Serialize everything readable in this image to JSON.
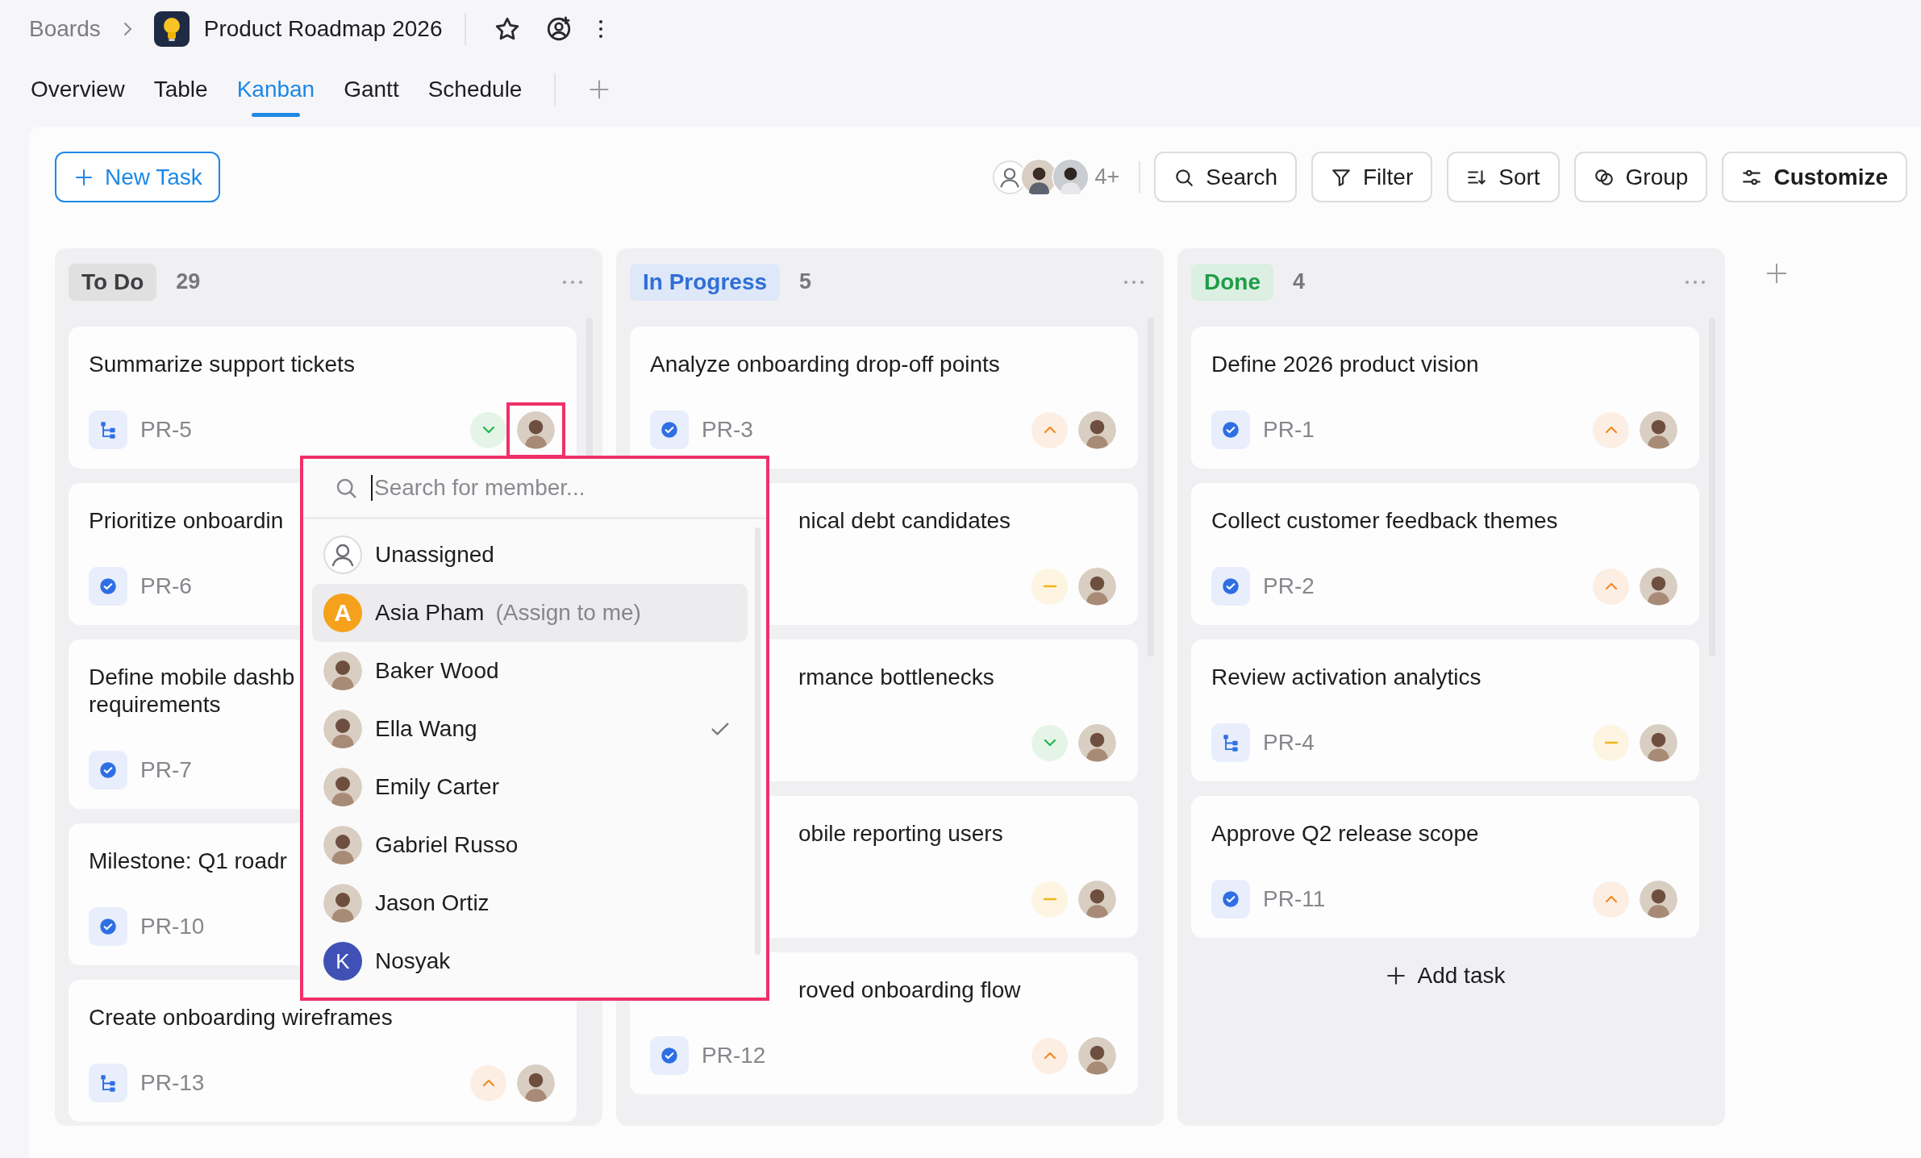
{
  "breadcrumb": {
    "parent": "Boards",
    "title": "Product Roadmap 2026"
  },
  "views": [
    {
      "label": "Overview",
      "selected": false
    },
    {
      "label": "Table",
      "selected": false
    },
    {
      "label": "Kanban",
      "selected": true
    },
    {
      "label": "Gantt",
      "selected": false
    },
    {
      "label": "Schedule",
      "selected": false
    }
  ],
  "new_task_button": "New Task",
  "members_more": "4+",
  "toolbar": [
    {
      "label": "Search",
      "kind": "search",
      "primary": false
    },
    {
      "label": "Filter",
      "kind": "filter",
      "primary": false
    },
    {
      "label": "Sort",
      "kind": "sort",
      "primary": false
    },
    {
      "label": "Group",
      "kind": "group",
      "primary": false
    },
    {
      "label": "Customize",
      "kind": "customize",
      "primary": true
    }
  ],
  "columns": [
    {
      "title": "To Do",
      "color": "#3d3d42",
      "count": "29",
      "cards": [
        {
          "title": "Summarize support tickets",
          "task_type": {
            "kind": "subtask"
          },
          "id": "PR-5",
          "priority": {
            "kind": "low"
          },
          "avatar": true,
          "focused": true
        },
        {
          "title": "Prioritize onboardin",
          "task_type": {
            "kind": "task"
          },
          "id": "PR-6"
        },
        {
          "title": "Define mobile dashb\nrequirements",
          "task_type": {
            "kind": "task"
          },
          "id": "PR-7"
        },
        {
          "title": "Milestone: Q1 roadr",
          "task_type": {
            "kind": "task"
          },
          "id": "PR-10"
        },
        {
          "title": "Create onboarding wireframes",
          "task_type": {
            "kind": "subtask"
          },
          "id": "PR-13",
          "priority": {
            "kind": "high"
          },
          "avatar": true
        }
      ]
    },
    {
      "title": "In Progress",
      "color": "#2f6fd6",
      "count": "5",
      "cards": [
        {
          "title": "Analyze onboarding drop-off points",
          "task_type": {
            "kind": "task"
          },
          "id": "PR-3",
          "priority": {
            "kind": "high"
          },
          "avatar": true
        },
        {
          "title": "nical debt candidates",
          "clipped": true,
          "priority": {
            "kind": "medium"
          },
          "avatar": true
        },
        {
          "title": "rmance bottlenecks",
          "clipped": true,
          "priority": {
            "kind": "low"
          },
          "avatar": true
        },
        {
          "title": "obile reporting users",
          "clipped": true,
          "priority": {
            "kind": "medium"
          },
          "avatar": true
        },
        {
          "title": "roved onboarding flow",
          "clipped": true,
          "task_type": {
            "kind": "task"
          },
          "id": "PR-12",
          "priority": {
            "kind": "high"
          },
          "avatar": true
        }
      ]
    },
    {
      "title": "Done",
      "color": "#1f9d48",
      "count": "4",
      "add_task": "Add task",
      "cards": [
        {
          "title": "Define 2026 product vision",
          "task_type": {
            "kind": "task"
          },
          "id": "PR-1",
          "priority": {
            "kind": "high"
          },
          "avatar": true
        },
        {
          "title": "Collect customer feedback themes",
          "task_type": {
            "kind": "task"
          },
          "id": "PR-2",
          "priority": {
            "kind": "high"
          },
          "avatar": true
        },
        {
          "title": "Review activation analytics",
          "task_type": {
            "kind": "subtask"
          },
          "id": "PR-4",
          "priority": {
            "kind": "medium"
          },
          "avatar": true
        },
        {
          "title": "Approve Q2 release scope",
          "task_type": {
            "kind": "task"
          },
          "id": "PR-11",
          "priority": {
            "kind": "high"
          },
          "avatar": true
        }
      ]
    }
  ],
  "member_picker": {
    "placeholder": "Search for member...",
    "members": [
      {
        "name": "Unassigned",
        "kind": "none",
        "selected": false,
        "highlighted": false
      },
      {
        "name": "Asia Pham",
        "note": "(Assign to me)",
        "kind": "letter",
        "initial": "A",
        "color": "#f5a11c",
        "selected": false,
        "highlighted": true
      },
      {
        "name": "Baker Wood",
        "kind": "photo",
        "selected": false,
        "highlighted": false
      },
      {
        "name": "Ella Wang",
        "kind": "photo",
        "selected": true,
        "highlighted": false
      },
      {
        "name": "Emily Carter",
        "kind": "photo",
        "selected": false,
        "highlighted": false
      },
      {
        "name": "Gabriel Russo",
        "kind": "photo",
        "selected": false,
        "highlighted": false
      },
      {
        "name": "Jason Ortiz",
        "kind": "photo",
        "selected": false,
        "highlighted": false
      },
      {
        "name": "Nosyak",
        "kind": "letter",
        "initial": "K",
        "color": "#3f51b5",
        "selected": false,
        "highlighted": false
      }
    ]
  }
}
